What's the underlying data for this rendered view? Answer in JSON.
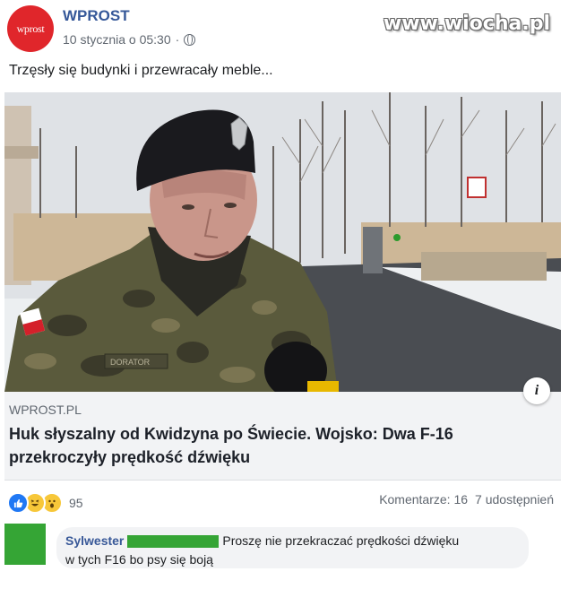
{
  "post": {
    "avatar_text": "wprost",
    "page_name": "WPROST",
    "timestamp": "10 stycznia o 05:30",
    "watermark": "www.wiocha.pl",
    "text": "Trzęsły się budynki i przewracały meble..."
  },
  "media": {
    "nameplate": "DORATOR"
  },
  "link_card": {
    "domain": "WPROST.PL",
    "headline": "Huk słyszalny od Kwidzyna po Świecie. Wojsko: Dwa F-16 przekroczyły prędkość dźwięku",
    "info_icon_glyph": "i"
  },
  "reactions": {
    "icons": [
      "like-icon",
      "haha-icon",
      "wow-icon"
    ],
    "count": "95",
    "comments": "Komentarze: 16",
    "shares": "7 udostępnień"
  },
  "comment": {
    "author": "Sylwester",
    "text_line1": "Proszę nie przekraczać prędkości dźwięku",
    "text_line2": "w tych F16 bo psy się boją"
  },
  "colors": {
    "brand_red": "#e0262b",
    "link_blue": "#365899",
    "like_blue": "#2078f4",
    "redaction_green": "#35a535"
  }
}
